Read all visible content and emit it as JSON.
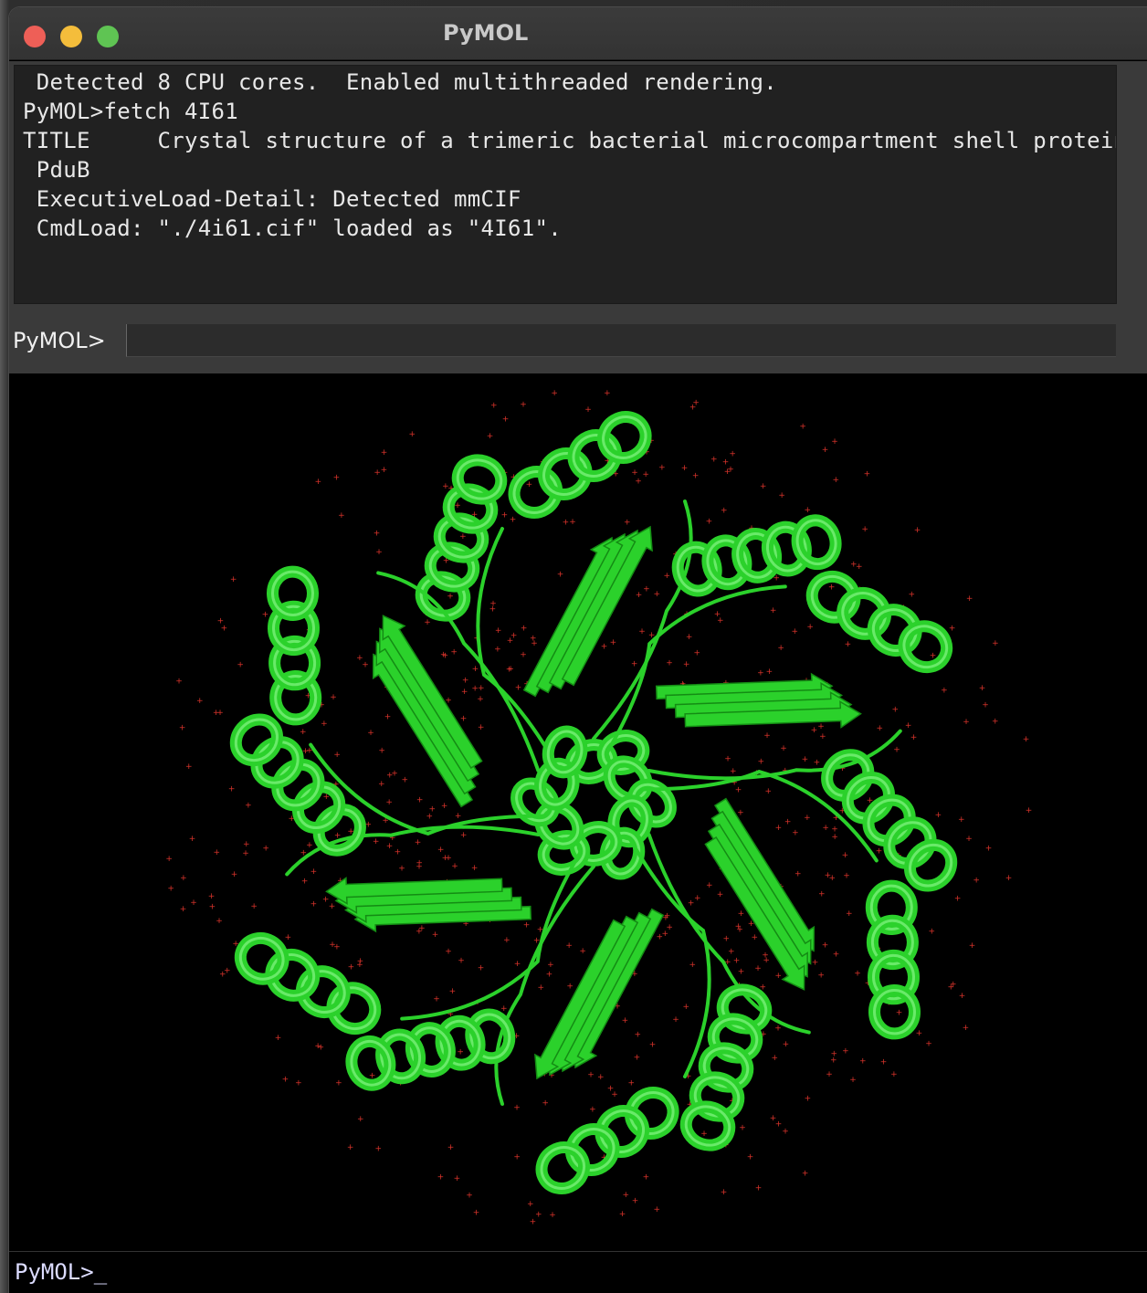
{
  "window": {
    "title": "PyMOL"
  },
  "console": {
    "lines": [
      " Detected 8 CPU cores.  Enabled multithreaded rendering.",
      "",
      "PyMOL>fetch 4I61",
      "TITLE     Crystal structure of a trimeric bacterial microcompartment shell protein",
      " PduB",
      " ExecutiveLoad-Detail: Detected mmCIF",
      " CmdLoad: \"./4i61.cif\" loaded as \"4I61\"."
    ]
  },
  "command": {
    "label": "PyMOL>",
    "value": ""
  },
  "viewer": {
    "structure": "4I61",
    "representation": "cartoon",
    "cartoon_color": "#2bd12b",
    "water_color": "#d9342b",
    "background": "#000000"
  },
  "bottom_prompt": {
    "text": "PyMOL>_"
  }
}
